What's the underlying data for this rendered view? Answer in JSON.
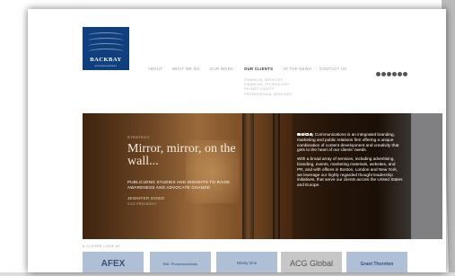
{
  "logo": {
    "name": "BACKBAY",
    "sub": "communications"
  },
  "nav": {
    "items": [
      "ABOUT",
      "WHAT WE DO",
      "OUR WORK",
      "OUR CLIENTS",
      "IN THE NEWS",
      "CONTACT US"
    ],
    "active": "OUR CLIENTS"
  },
  "submenu": [
    "FINANCIAL SERVICES",
    "FINANCIAL TECHNOLOGY",
    "PRIVATE EQUITY",
    "PROFESSIONAL SERVICES"
  ],
  "social": [
    "social-icon-1",
    "social-icon-2",
    "social-icon-3",
    "social-icon-4",
    "social-icon-5",
    "social-icon-6"
  ],
  "hero": {
    "label": "STRATEGY",
    "headline": "Mirror, mirror, on the wall...",
    "tagline": "PUBLICIZING STUDIES AND INSIGHTS TO RAISE AWARENESS AND ADVOCATE CHANGE",
    "author": "JENNIFER DOWD",
    "author_role": "VICE PRESIDENT",
    "slides": 4,
    "active_slide": 1,
    "paragraph1": "BackBay Communications is an integrated branding, marketing and public relations firm offering a unique combination of content development and creativity that gets to the heart of our clients' needs",
    "paragraph2": "With a broad array of services, including advertising, branding, events, marketing materials, websites, and PR, and with offices in Boston, London and New York, we leverage our highly regarded thought leadership initiatives, that serve our clients across the United States and Europe."
  },
  "closer_look": "A CLOSER LOOK AT:",
  "clients": [
    "AFEX",
    "BNL Pharmaceuticals",
    "Ninety One",
    "ACG Global",
    "Grant Thornton"
  ]
}
